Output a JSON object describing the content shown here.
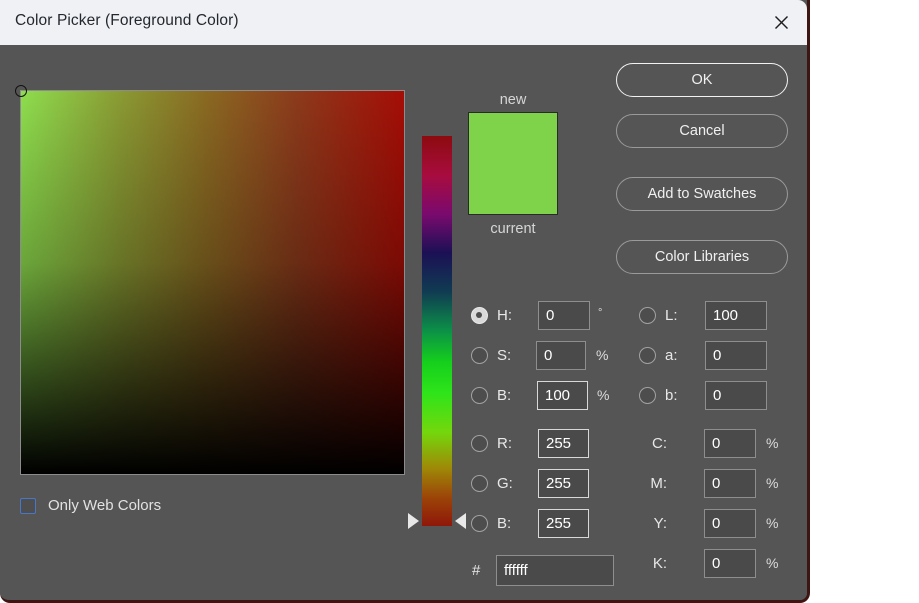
{
  "window": {
    "title": "Color Picker (Foreground Color)",
    "close_icon": "close-icon"
  },
  "swatch": {
    "new_label": "new",
    "current_label": "current",
    "color": "#7ed34a"
  },
  "buttons": {
    "ok": "OK",
    "cancel": "Cancel",
    "add_to_swatches": "Add to Swatches",
    "color_libraries": "Color Libraries"
  },
  "options": {
    "only_web_colors_label": "Only Web Colors",
    "only_web_colors_checked": false
  },
  "hsb": {
    "selected": "H",
    "h": {
      "label": "H:",
      "value": "0",
      "unit": "°"
    },
    "s": {
      "label": "S:",
      "value": "0",
      "unit": "%"
    },
    "b": {
      "label": "B:",
      "value": "100",
      "unit": "%"
    }
  },
  "lab": {
    "l": {
      "label": "L:",
      "value": "100"
    },
    "a": {
      "label": "a:",
      "value": "0"
    },
    "b": {
      "label": "b:",
      "value": "0"
    }
  },
  "rgb": {
    "r": {
      "label": "R:",
      "value": "255"
    },
    "g": {
      "label": "G:",
      "value": "255"
    },
    "b": {
      "label": "B:",
      "value": "255"
    }
  },
  "cmyk": {
    "c": {
      "label": "C:",
      "value": "0",
      "unit": "%"
    },
    "m": {
      "label": "M:",
      "value": "0",
      "unit": "%"
    },
    "y": {
      "label": "Y:",
      "value": "0",
      "unit": "%"
    },
    "k": {
      "label": "K:",
      "value": "0",
      "unit": "%"
    }
  },
  "hex": {
    "label": "#",
    "value": "ffffff"
  }
}
